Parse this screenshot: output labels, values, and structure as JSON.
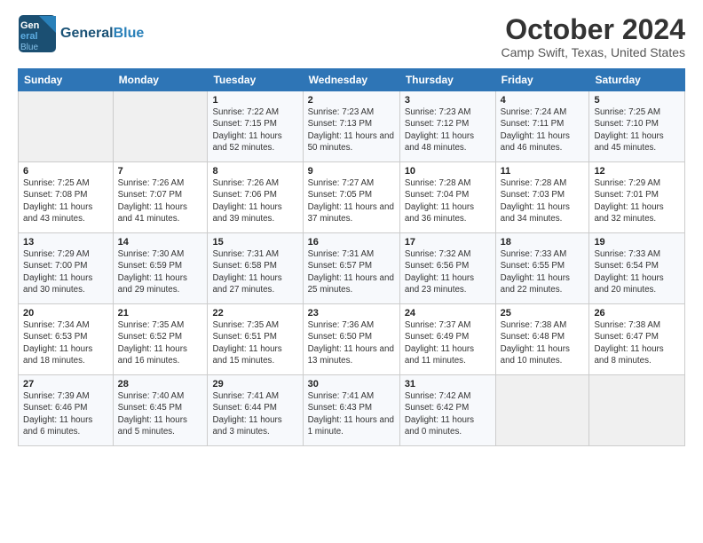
{
  "header": {
    "logo_line1": "General",
    "logo_line2": "Blue",
    "title": "October 2024",
    "location": "Camp Swift, Texas, United States"
  },
  "weekdays": [
    "Sunday",
    "Monday",
    "Tuesday",
    "Wednesday",
    "Thursday",
    "Friday",
    "Saturday"
  ],
  "weeks": [
    [
      {
        "day": "",
        "info": ""
      },
      {
        "day": "",
        "info": ""
      },
      {
        "day": "1",
        "info": "Sunrise: 7:22 AM\nSunset: 7:15 PM\nDaylight: 11 hours and 52 minutes."
      },
      {
        "day": "2",
        "info": "Sunrise: 7:23 AM\nSunset: 7:13 PM\nDaylight: 11 hours and 50 minutes."
      },
      {
        "day": "3",
        "info": "Sunrise: 7:23 AM\nSunset: 7:12 PM\nDaylight: 11 hours and 48 minutes."
      },
      {
        "day": "4",
        "info": "Sunrise: 7:24 AM\nSunset: 7:11 PM\nDaylight: 11 hours and 46 minutes."
      },
      {
        "day": "5",
        "info": "Sunrise: 7:25 AM\nSunset: 7:10 PM\nDaylight: 11 hours and 45 minutes."
      }
    ],
    [
      {
        "day": "6",
        "info": "Sunrise: 7:25 AM\nSunset: 7:08 PM\nDaylight: 11 hours and 43 minutes."
      },
      {
        "day": "7",
        "info": "Sunrise: 7:26 AM\nSunset: 7:07 PM\nDaylight: 11 hours and 41 minutes."
      },
      {
        "day": "8",
        "info": "Sunrise: 7:26 AM\nSunset: 7:06 PM\nDaylight: 11 hours and 39 minutes."
      },
      {
        "day": "9",
        "info": "Sunrise: 7:27 AM\nSunset: 7:05 PM\nDaylight: 11 hours and 37 minutes."
      },
      {
        "day": "10",
        "info": "Sunrise: 7:28 AM\nSunset: 7:04 PM\nDaylight: 11 hours and 36 minutes."
      },
      {
        "day": "11",
        "info": "Sunrise: 7:28 AM\nSunset: 7:03 PM\nDaylight: 11 hours and 34 minutes."
      },
      {
        "day": "12",
        "info": "Sunrise: 7:29 AM\nSunset: 7:01 PM\nDaylight: 11 hours and 32 minutes."
      }
    ],
    [
      {
        "day": "13",
        "info": "Sunrise: 7:29 AM\nSunset: 7:00 PM\nDaylight: 11 hours and 30 minutes."
      },
      {
        "day": "14",
        "info": "Sunrise: 7:30 AM\nSunset: 6:59 PM\nDaylight: 11 hours and 29 minutes."
      },
      {
        "day": "15",
        "info": "Sunrise: 7:31 AM\nSunset: 6:58 PM\nDaylight: 11 hours and 27 minutes."
      },
      {
        "day": "16",
        "info": "Sunrise: 7:31 AM\nSunset: 6:57 PM\nDaylight: 11 hours and 25 minutes."
      },
      {
        "day": "17",
        "info": "Sunrise: 7:32 AM\nSunset: 6:56 PM\nDaylight: 11 hours and 23 minutes."
      },
      {
        "day": "18",
        "info": "Sunrise: 7:33 AM\nSunset: 6:55 PM\nDaylight: 11 hours and 22 minutes."
      },
      {
        "day": "19",
        "info": "Sunrise: 7:33 AM\nSunset: 6:54 PM\nDaylight: 11 hours and 20 minutes."
      }
    ],
    [
      {
        "day": "20",
        "info": "Sunrise: 7:34 AM\nSunset: 6:53 PM\nDaylight: 11 hours and 18 minutes."
      },
      {
        "day": "21",
        "info": "Sunrise: 7:35 AM\nSunset: 6:52 PM\nDaylight: 11 hours and 16 minutes."
      },
      {
        "day": "22",
        "info": "Sunrise: 7:35 AM\nSunset: 6:51 PM\nDaylight: 11 hours and 15 minutes."
      },
      {
        "day": "23",
        "info": "Sunrise: 7:36 AM\nSunset: 6:50 PM\nDaylight: 11 hours and 13 minutes."
      },
      {
        "day": "24",
        "info": "Sunrise: 7:37 AM\nSunset: 6:49 PM\nDaylight: 11 hours and 11 minutes."
      },
      {
        "day": "25",
        "info": "Sunrise: 7:38 AM\nSunset: 6:48 PM\nDaylight: 11 hours and 10 minutes."
      },
      {
        "day": "26",
        "info": "Sunrise: 7:38 AM\nSunset: 6:47 PM\nDaylight: 11 hours and 8 minutes."
      }
    ],
    [
      {
        "day": "27",
        "info": "Sunrise: 7:39 AM\nSunset: 6:46 PM\nDaylight: 11 hours and 6 minutes."
      },
      {
        "day": "28",
        "info": "Sunrise: 7:40 AM\nSunset: 6:45 PM\nDaylight: 11 hours and 5 minutes."
      },
      {
        "day": "29",
        "info": "Sunrise: 7:41 AM\nSunset: 6:44 PM\nDaylight: 11 hours and 3 minutes."
      },
      {
        "day": "30",
        "info": "Sunrise: 7:41 AM\nSunset: 6:43 PM\nDaylight: 11 hours and 1 minute."
      },
      {
        "day": "31",
        "info": "Sunrise: 7:42 AM\nSunset: 6:42 PM\nDaylight: 11 hours and 0 minutes."
      },
      {
        "day": "",
        "info": ""
      },
      {
        "day": "",
        "info": ""
      }
    ]
  ]
}
